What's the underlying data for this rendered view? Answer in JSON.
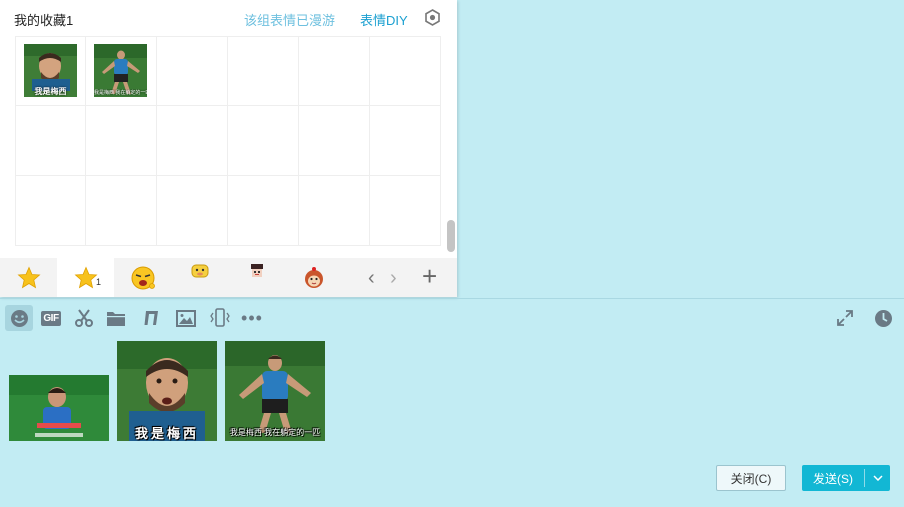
{
  "panel": {
    "title": "我的收藏1",
    "roam_status": "该组表情已漫游",
    "diy_label": "表情DIY",
    "thumbs": [
      {
        "caption": "我是梅西"
      },
      {
        "caption": "我是梅西 我在躺定的一匹"
      }
    ],
    "tabs": [
      {
        "icon": "star-icon"
      },
      {
        "icon": "star-icon",
        "badge": "1"
      },
      {
        "icon": "emoji-face-icon"
      },
      {
        "icon": "pig-emoji-icon"
      },
      {
        "icon": "pixel-emoji-icon"
      },
      {
        "icon": "monkey-emoji-icon"
      }
    ],
    "nav": {
      "prev": "‹",
      "next": "›",
      "add": "+"
    }
  },
  "toolbar": {
    "gif_label": "GIF",
    "more_label": "•••"
  },
  "messages": {
    "images": [
      {
        "caption": "我是梅西"
      },
      {
        "caption": "我是梅西 我在躺定的一匹"
      }
    ]
  },
  "buttons": {
    "close": "关闭(C)",
    "send": "发送(S)"
  },
  "colors": {
    "background": "#c2ecf3",
    "accent": "#12b7d4",
    "link": "#1a9fd0"
  }
}
